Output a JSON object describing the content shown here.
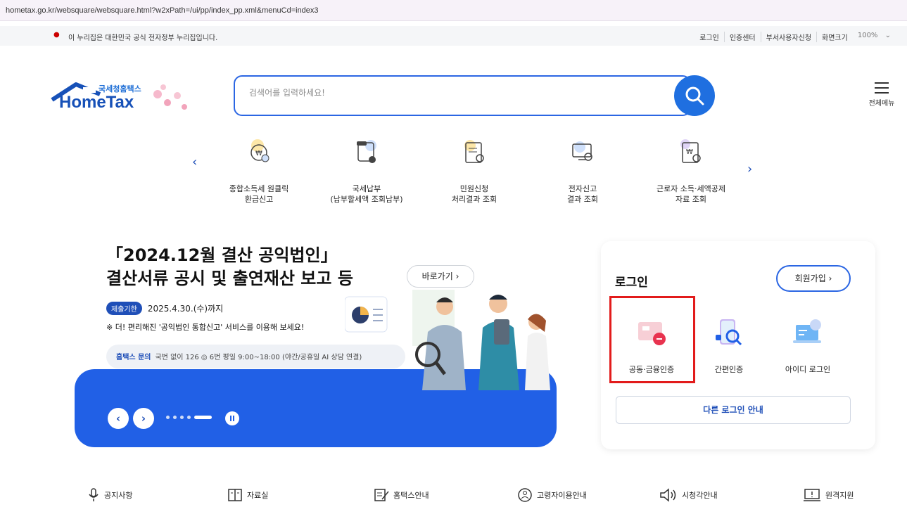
{
  "browser": {
    "url": "hometax.go.kr/websquare/websquare.html?w2xPath=/ui/pp/index_pp.xml&menuCd=index3"
  },
  "gov_banner": {
    "text": "이 누리집은 대한민국 공식 전자정부 누리집입니다.",
    "links": [
      "로그인",
      "인증센터",
      "부서사용자신청",
      "화면크기"
    ],
    "zoom": "100%"
  },
  "header": {
    "logo_sub": "국세청홈택스",
    "logo_main": "HomeTax",
    "search_placeholder": "검색어를 입력하세요!",
    "menu_label": "전체메뉴"
  },
  "quick_menu": [
    {
      "line1": "종합소득세 원클릭",
      "line2": "환급신고",
      "icon": "refund-icon"
    },
    {
      "line1": "국세납부",
      "line2": "(납부할세액 조회납부)",
      "icon": "tax-payment-icon"
    },
    {
      "line1": "민원신청",
      "line2": "처리결과 조회",
      "icon": "civil-request-icon"
    },
    {
      "line1": "전자신고",
      "line2": "결과 조회",
      "icon": "e-filing-icon"
    },
    {
      "line1": "근로자 소득·세액공제",
      "line2": "자료 조회",
      "icon": "deduction-icon"
    }
  ],
  "hero": {
    "title_line1": "「2024.12월 결산 공익법인」",
    "title_line2": "결산서류 공시 및 출연재산 보고 등",
    "go_label": "바로가기",
    "deadline_badge": "제출기한",
    "deadline": "2025.4.30.(수)까지",
    "note": "※ 더! 편리해진 '공익법인 통합신고' 서비스를 이용해 보세요!",
    "contact_label": "홈택스 문의",
    "contact_text": "국번 없이 126 ◎ 6번 평일 9:00~18:00 (야간/공휴일 AI 상담 연결)"
  },
  "login": {
    "title": "로그인",
    "join_label": "회원가입",
    "options": [
      "공동·금융인증",
      "간편인증",
      "아이디 로그인"
    ],
    "other_label": "다른 로그인 안내"
  },
  "bottom_nav": [
    "공지사항",
    "자료실",
    "홈택스안내",
    "고령자이용안내",
    "시청각안내",
    "원격지원"
  ],
  "colors": {
    "primary": "#2160e6",
    "brand": "#1751b8",
    "highlight": "#e21b1b"
  }
}
